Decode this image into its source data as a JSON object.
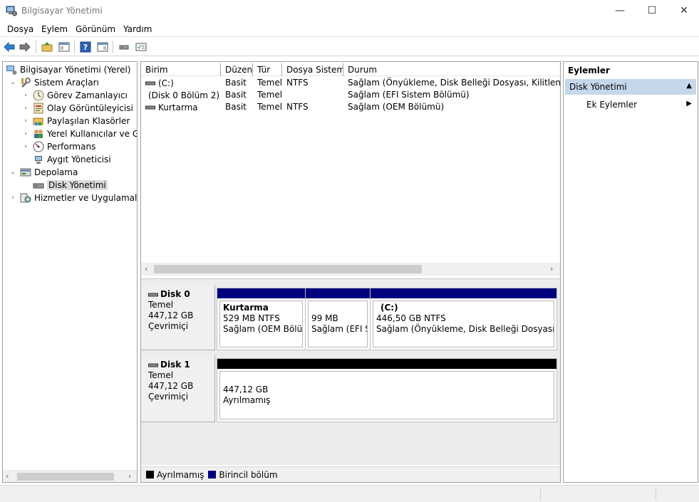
{
  "window": {
    "title": "Bilgisayar Yönetimi",
    "minimize": "—",
    "maximize": "☐",
    "close": "✕"
  },
  "menu": [
    "Dosya",
    "Eylem",
    "Görünüm",
    "Yardım"
  ],
  "toolbar": {
    "icons": [
      "back-arrow-icon",
      "forward-arrow-icon",
      "up-folder-icon",
      "show-hide-tree-icon",
      "help-icon",
      "show-hide-action-pane-icon",
      "connect-icon",
      "properties-icon"
    ]
  },
  "tree": {
    "items": [
      {
        "label": "Bilgisayar Yönetimi (Yerel)",
        "expander": "",
        "icon": "computer-management-icon"
      },
      {
        "label": "Sistem Araçları",
        "expander": "⌄",
        "icon": "system-tools-icon"
      },
      {
        "label": "Görev Zamanlayıcı",
        "expander": "›",
        "icon": "clock-icon"
      },
      {
        "label": "Olay Görüntüleyicisi",
        "expander": "›",
        "icon": "event-viewer-icon"
      },
      {
        "label": "Paylaşılan Klasörler",
        "expander": "›",
        "icon": "shared-folders-icon"
      },
      {
        "label": "Yerel Kullanıcılar ve Gru",
        "expander": "›",
        "icon": "users-icon"
      },
      {
        "label": "Performans",
        "expander": "›",
        "icon": "performance-icon"
      },
      {
        "label": "Aygıt Yöneticisi",
        "expander": "",
        "icon": "device-manager-icon"
      },
      {
        "label": "Depolama",
        "expander": "⌄",
        "icon": "storage-icon"
      },
      {
        "label": "Disk Yönetimi",
        "expander": "",
        "icon": "disk-icon"
      },
      {
        "label": "Hizmetler ve Uygulamalar",
        "expander": "›",
        "icon": "services-icon"
      }
    ]
  },
  "volumes": {
    "headers": [
      "Birim",
      "Düzen",
      "Tür",
      "Dosya Sistemi",
      "Durum"
    ],
    "rows": [
      {
        "birim": "(C:)",
        "duzen": "Basit",
        "tur": "Temel",
        "fs": "NTFS",
        "durum": "Sağlam (Önyükleme, Disk Belleği Dosyası, Kilitlenme Bilg"
      },
      {
        "birim": "(Disk 0 Bölüm 2)",
        "duzen": "Basit",
        "tur": "Temel",
        "fs": "",
        "durum": "Sağlam (EFI Sistem Bölümü)"
      },
      {
        "birim": "Kurtarma",
        "duzen": "Basit",
        "tur": "Temel",
        "fs": "NTFS",
        "durum": "Sağlam (OEM Bölümü)"
      }
    ]
  },
  "disks": [
    {
      "name": "Disk 0",
      "type": "Temel",
      "size": "447,12 GB",
      "state": "Çevrimiçi",
      "partitions": [
        {
          "name": "Kurtarma",
          "size": "529 MB NTFS",
          "status": "Sağlam (OEM Bölüm"
        },
        {
          "name": "",
          "size": "99 MB",
          "status": "Sağlam (EFI Sis"
        },
        {
          "name": "(C:)",
          "size": "446,50 GB NTFS",
          "status": "Sağlam (Önyükleme, Disk Belleği Dosyası, Kilitl"
        }
      ]
    },
    {
      "name": "Disk 1",
      "type": "Temel",
      "size": "447,12 GB",
      "state": "Çevrimiçi",
      "partitions": [
        {
          "name": "",
          "size": "447,12 GB",
          "status": "Ayrılmamış"
        }
      ]
    }
  ],
  "legend": {
    "unallocated": "Ayrılmamış",
    "primary": "Birincil bölüm"
  },
  "colors": {
    "primary": "#00007f",
    "unallocated": "#000000",
    "action_selected": "#c5d7ea"
  },
  "actions": {
    "header": "Eylemler",
    "section": "Disk Yönetimi",
    "item": "Ek Eylemler"
  }
}
